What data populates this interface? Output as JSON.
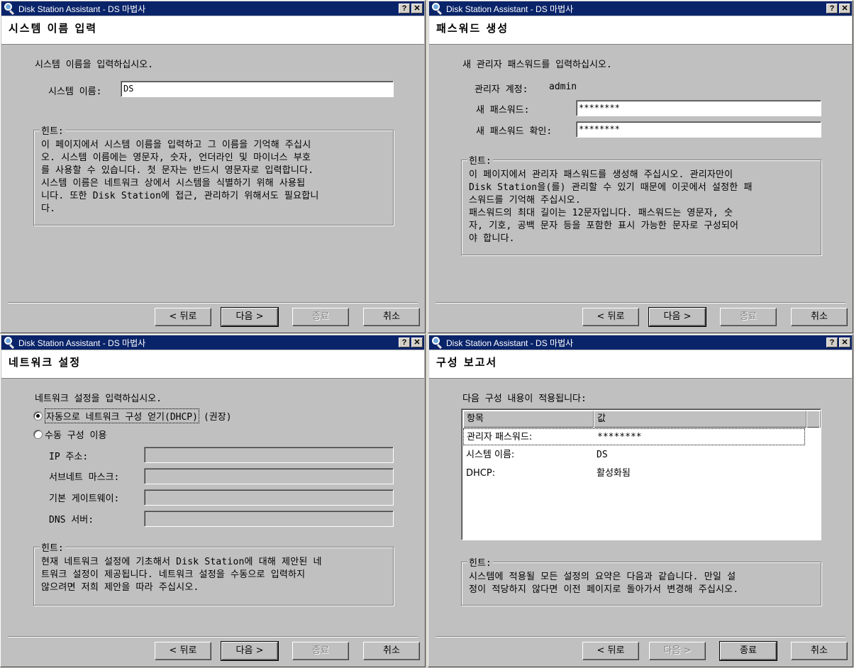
{
  "app_title": "Disk Station Assistant - DS 마법사",
  "titlebar_buttons": {
    "help": "?",
    "close": "✕"
  },
  "buttons": {
    "back": "< 뒤로",
    "next": "다음 >",
    "finish": "종료",
    "cancel": "취소"
  },
  "hint_legend": "힌트:",
  "icons": {
    "app": "magnifier-icon",
    "help": "help-icon",
    "close": "close-icon"
  },
  "colors": {
    "titlebar": "#0a246a",
    "dialog": "#c0c0c0",
    "header": "#ffffff"
  },
  "system_name_page": {
    "heading": "시스템 이름 입력",
    "instruction": "시스템 이름을 입력하십시오.",
    "name_label": "시스템 이름:",
    "name_value": "DS",
    "hint": "이 페이지에서 시스템 이름을 입력하고 그 이름을 기억해 주십시\n오. 시스템 이름에는 영문자, 숫자, 언더라인 및 마이너스 부호\n를 사용할 수 있습니다. 첫 문자는 반드시 영문자로 입력합니다.\n시스템 이름은 네트워크 상에서 시스템을 식별하기 위해 사용됩\n니다. 또한 Disk Station에 접근, 관리하기 위해서도 필요합니\n다."
  },
  "password_page": {
    "heading": "패스워드 생성",
    "instruction": "새 관리자 패스워드를 입력하십시오.",
    "account_label": "관리자 계정:",
    "account_value": "admin",
    "new_password_label": "새 패스워드:",
    "new_password_value": "********",
    "confirm_label": "새 패스워드 확인:",
    "confirm_value": "********",
    "hint": "이 페이지에서 관리자 패스워드를 생성해 주십시오. 관리자만이\nDisk Station을(를) 관리할 수 있기 때문에 이곳에서 설정한 패\n스워드를 기억해 주십시오.\n패스워드의 최대 길이는 12문자입니다. 패스워드는 영문자, 숫\n자, 기호, 공백 문자 등을 포함한 표시 가능한 문자로 구성되어\n야 합니다."
  },
  "network_page": {
    "heading": "네트워크 설정",
    "instruction": "네트워크 설정을 입력하십시오.",
    "dhcp_option": "자동으로 네트워크 구성 얻기(DHCP)",
    "dhcp_recommend": "(권장)",
    "manual_option": "수동 구성 이용",
    "ip_label": "IP 주소:",
    "subnet_label": "서브네트 마스크:",
    "gateway_label": "기본 게이트웨이:",
    "dns_label": "DNS 서버:",
    "hint": "현재 네트워크 설정에 기초해서 Disk Station에 대해 제안된 네\n트워크 설정이 제공됩니다. 네트워크 설정을 수동으로 입력하지\n않으려면 저희 제안을 따라 주십시오."
  },
  "summary_page": {
    "heading": "구성 보고서",
    "instruction": "다음 구성 내용이 적용됩니다:",
    "columns": [
      "항목",
      "값"
    ],
    "rows": [
      {
        "item": "관리자 패스워드:",
        "value": "********"
      },
      {
        "item": "시스템 이름:",
        "value": "DS"
      },
      {
        "item": "DHCP:",
        "value": "활성화됨"
      }
    ],
    "hint": "시스템에 적용될 모든 설정의 요약은 다음과 같습니다. 만일 설\n정이 적당하지 않다면 이전 페이지로 돌아가서 변경해 주십시오."
  }
}
